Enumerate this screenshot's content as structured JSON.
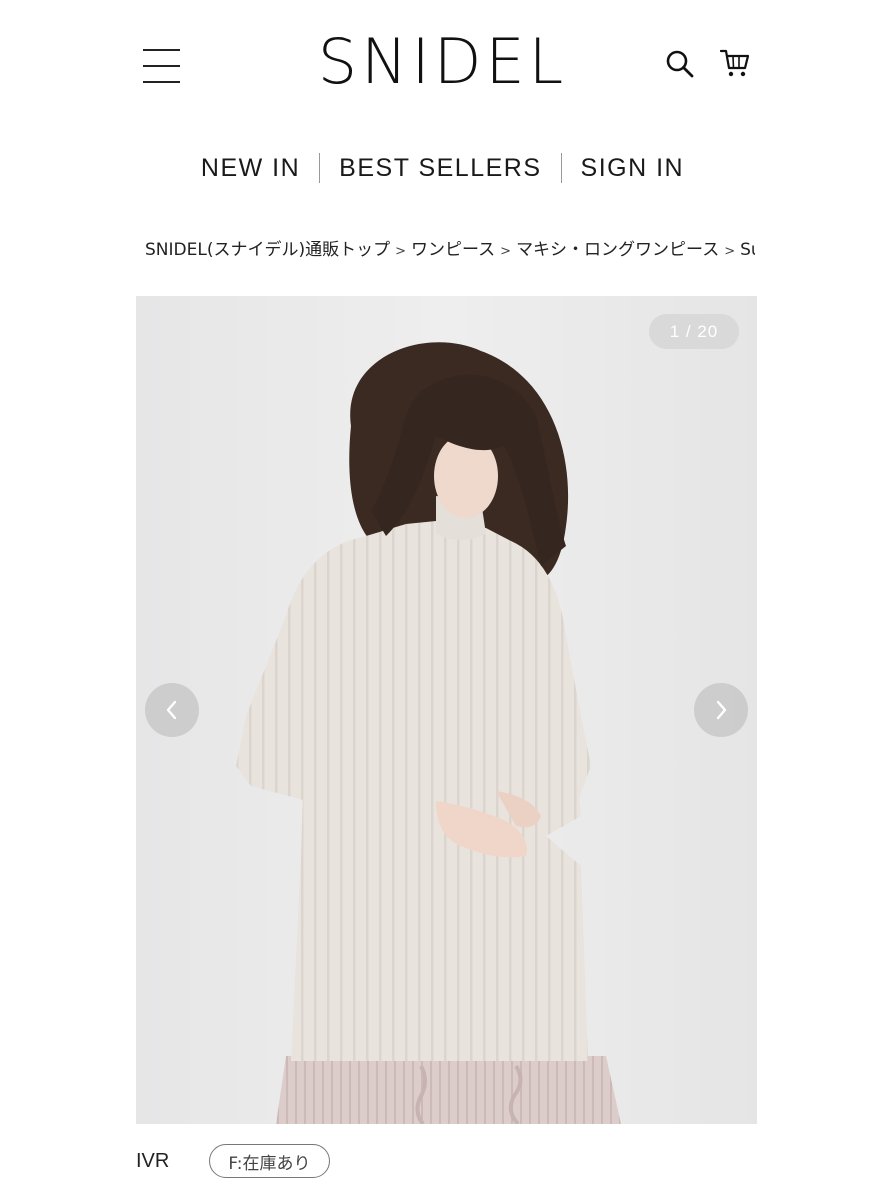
{
  "header": {
    "logo": "SNIDEL",
    "menu_icon": "hamburger-icon",
    "search_icon": "search-icon",
    "cart_icon": "cart-icon"
  },
  "nav": {
    "items": [
      {
        "label": "NEW IN"
      },
      {
        "label": "BEST SELLERS"
      },
      {
        "label": "SIGN IN"
      }
    ]
  },
  "breadcrumb": {
    "separator": ">",
    "items": [
      {
        "label": "SNIDEL(スナイデル)通販トップ"
      },
      {
        "label": "ワンピース"
      },
      {
        "label": "マキシ・ロングワンピース"
      },
      {
        "label": "Susta"
      }
    ]
  },
  "gallery": {
    "counter": "1 / 20",
    "current": 1,
    "total": 20,
    "prev_icon": "chevron-left-icon",
    "next_icon": "chevron-right-icon"
  },
  "variant": {
    "color_code": "IVR",
    "stock_label": "F:在庫あり"
  },
  "colors": {
    "text": "#1a1a1a",
    "background": "#ffffff",
    "photo_background": "#e9e9ea",
    "sweater": "#e9e2dc",
    "skirt": "#d8c8c6",
    "hair": "#3a2a22"
  }
}
